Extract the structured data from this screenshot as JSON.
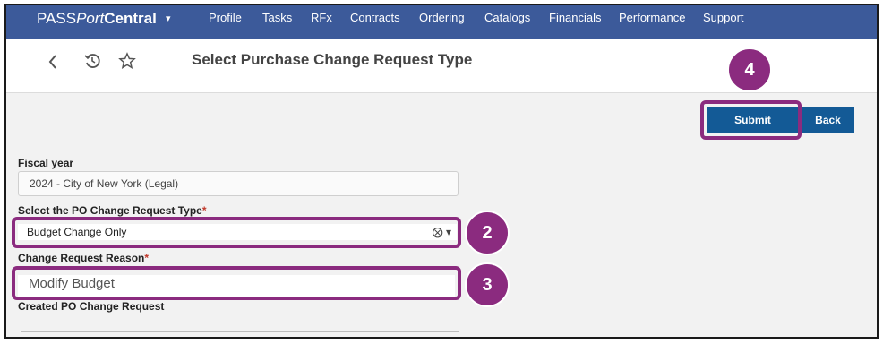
{
  "brand": {
    "part1": "PASS",
    "part2": "Port",
    "part3": "Central",
    "caret": "▾"
  },
  "nav": {
    "items": [
      {
        "label": "Profile"
      },
      {
        "label": "Tasks"
      },
      {
        "label": "RFx"
      },
      {
        "label": "Contracts"
      },
      {
        "label": "Ordering"
      },
      {
        "label": "Catalogs"
      },
      {
        "label": "Financials"
      },
      {
        "label": "Performance"
      },
      {
        "label": "Support"
      }
    ]
  },
  "subheader": {
    "back_icon": "chevron-left-icon",
    "history_icon": "history-icon",
    "favorite_icon": "star-icon",
    "title": "Select Purchase Change Request Type"
  },
  "actions": {
    "submit_label": "Submit",
    "back_label": "Back"
  },
  "form": {
    "fiscal_year": {
      "label": "Fiscal year",
      "value": "2024 - City of New York (Legal)"
    },
    "change_type": {
      "label": "Select the PO Change Request Type",
      "required_mark": "*",
      "value": "Budget Change Only",
      "clear_icon": "⨂",
      "caret": "▾"
    },
    "reason": {
      "label": "Change Request Reason",
      "required_mark": "*",
      "value": "Modify Budget"
    },
    "created": {
      "label": "Created PO Change Request"
    }
  },
  "callouts": {
    "step2": "2",
    "step3": "3",
    "step4": "4"
  },
  "colors": {
    "nav": "#3c5a9a",
    "button": "#135a96",
    "highlight": "#8b2b7f"
  }
}
